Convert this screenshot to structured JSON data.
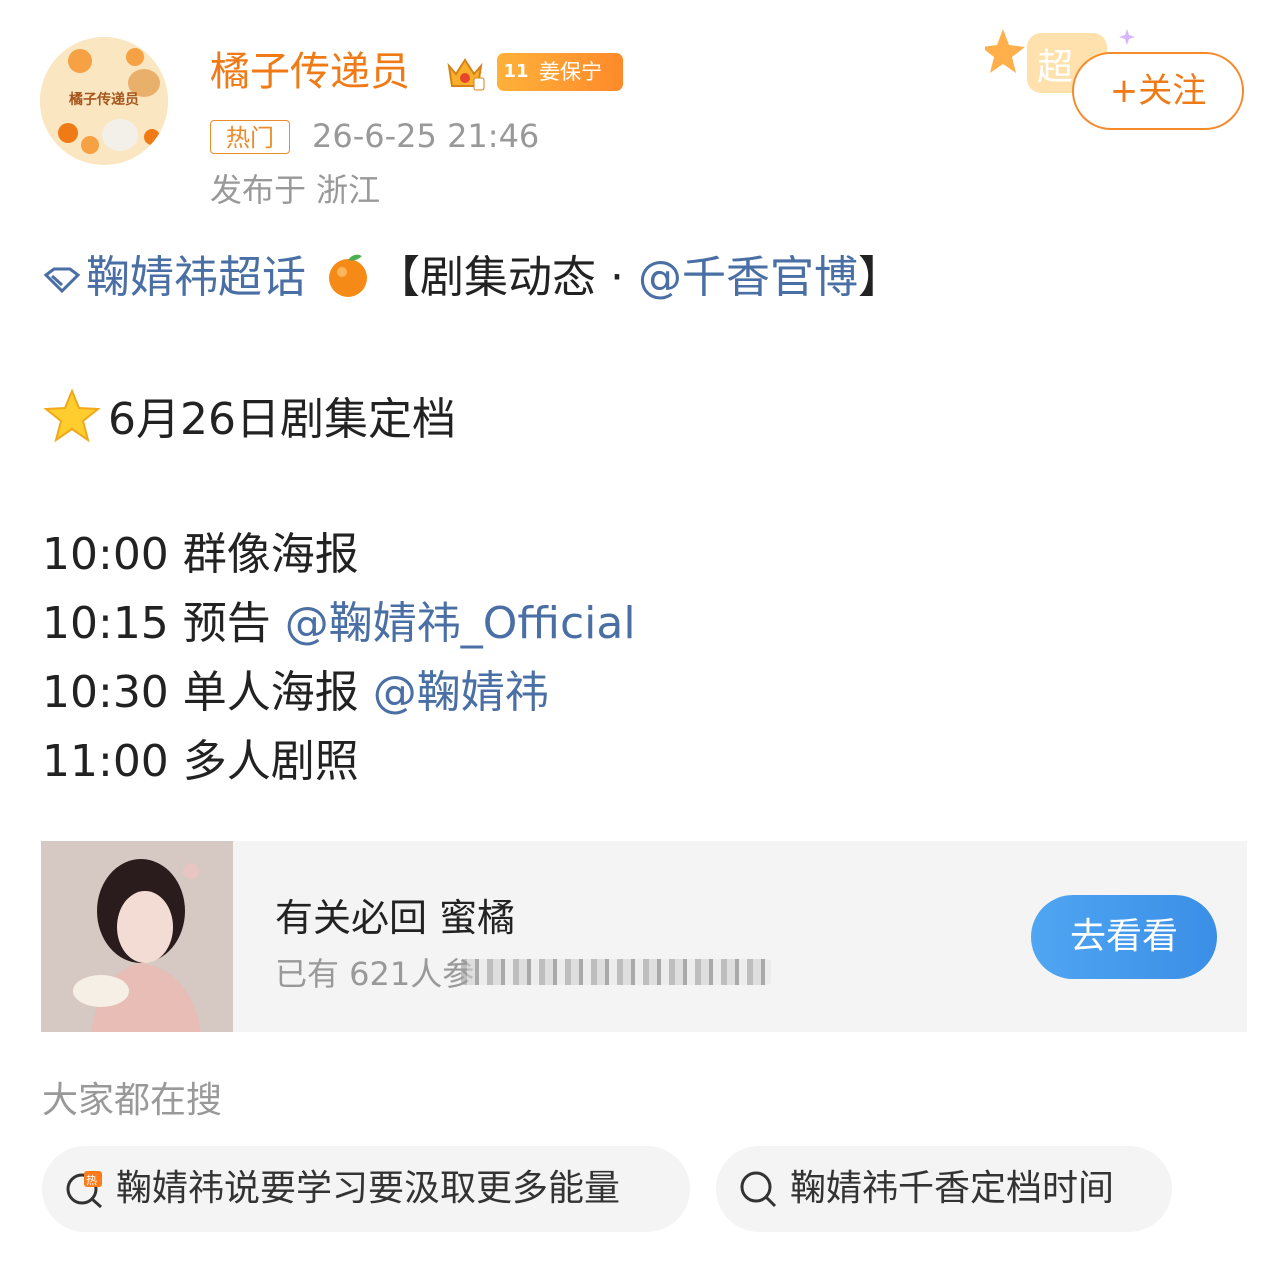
{
  "post": {
    "username": "橘子传递员",
    "badge_level": "11",
    "badge_name": "姜保宁",
    "hot_tag": "热门",
    "timestamp": "26-6-25 21:46",
    "location": "发布于 浙江",
    "follow_label": "+关注",
    "avatar_text": "橘子传递员"
  },
  "content": {
    "topic": "鞠婧祎超话",
    "bracket_open": "【剧集动态 · ",
    "mention_official": "@千香官博",
    "bracket_close": "】",
    "schedule_title": "6月26日剧集定档",
    "items": [
      {
        "time_text": "10:00 群像海报",
        "mention": ""
      },
      {
        "time_text": "10:15 预告 ",
        "mention": "@鞠婧祎_Official"
      },
      {
        "time_text": "10:30 单人海报 ",
        "mention": "@鞠婧祎"
      },
      {
        "time_text": "11:00 多人剧照",
        "mention": ""
      }
    ]
  },
  "card": {
    "title": "有关必回 蜜橘",
    "subtitle": "已有 621人参",
    "button": "去看看"
  },
  "search": {
    "title": "大家都在搜",
    "chips": [
      {
        "text": "鞠婧祎说要学习要汲取更多能量",
        "icon": "hot-search-icon"
      },
      {
        "text": "鞠婧祎千香定档时间",
        "icon": "search-icon"
      }
    ]
  },
  "colors": {
    "accent_orange": "#f07a16",
    "link_blue": "#4a6fa5",
    "button_blue": "#3b8ee6"
  }
}
